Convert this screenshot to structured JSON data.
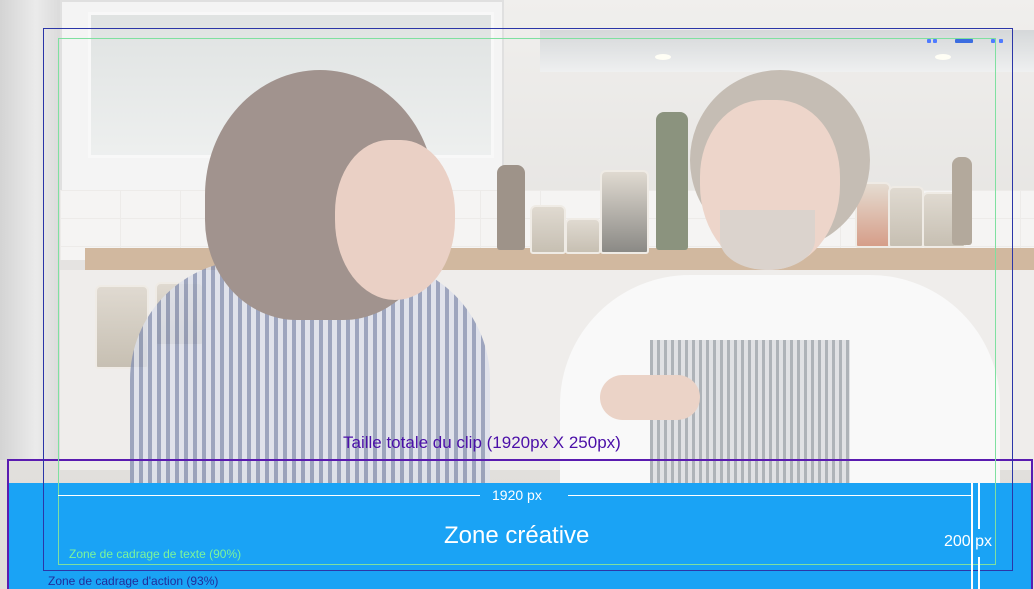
{
  "overlay": {
    "clip_size_label": "Taille totale du clip (1920px X 250px)",
    "width_label": "1920 px",
    "creative_zone_label": "Zone créative",
    "height_label": "200 px",
    "text_safe_label": "Zone de cadrage de texte (90%)",
    "action_safe_label": "Zone de cadrage d'action (93%)"
  },
  "colors": {
    "creative_zone": "#1aa3f5",
    "clip_outline": "#5a1bb0",
    "action_safe": "#2b36a8",
    "text_safe": "#7fe0a0"
  },
  "background": {
    "description_icon": "kitchen-video-frame"
  }
}
